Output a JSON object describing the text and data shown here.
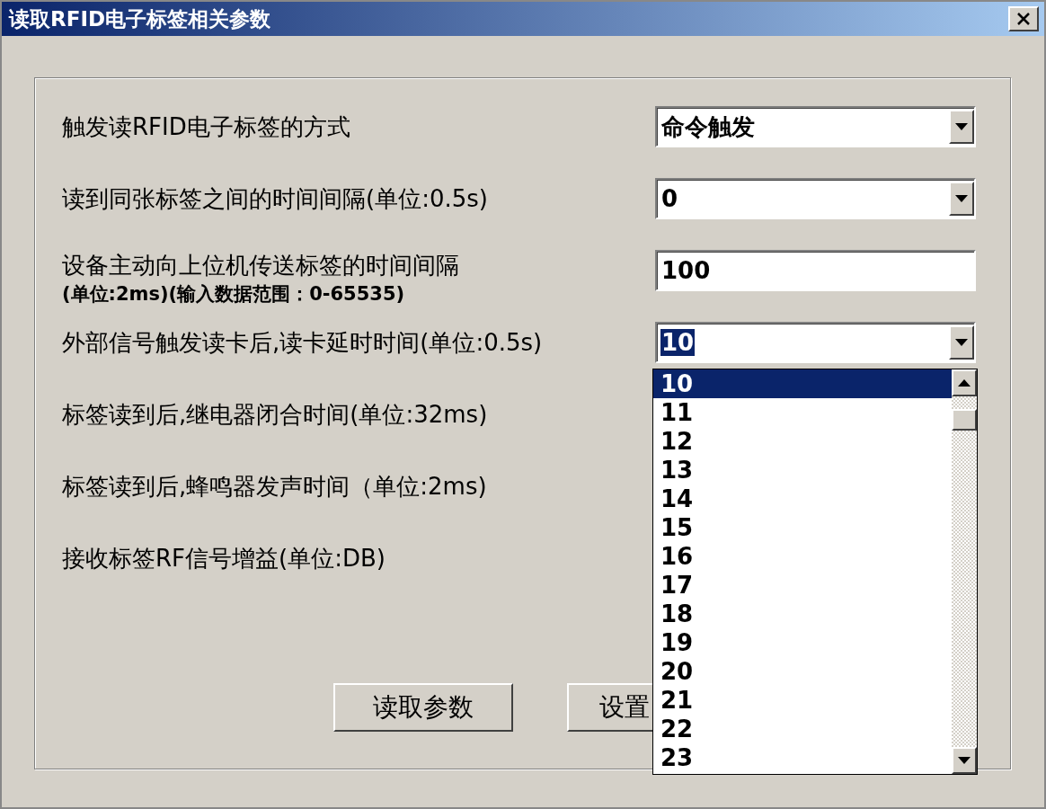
{
  "window": {
    "title": "读取RFID电子标签相关参数"
  },
  "rows": [
    {
      "label": "触发读RFID电子标签的方式",
      "field": {
        "kind": "combo",
        "value": "命令触发",
        "text_selected": false
      }
    },
    {
      "label": "读到同张标签之间的时间间隔(单位:0.5s)",
      "field": {
        "kind": "combo",
        "value": "0",
        "text_selected": false
      }
    },
    {
      "label": "设备主动向上位机传送标签的时间间隔",
      "note": "(单位:2ms)(输入数据范围：0-65535)",
      "field": {
        "kind": "edit",
        "value": "100",
        "text_selected": false
      }
    },
    {
      "label": "外部信号触发读卡后,读卡延时时间(单位:0.5s)",
      "field": {
        "kind": "combo",
        "value": "10",
        "text_selected": true
      }
    },
    {
      "label": "标签读到后,继电器闭合时间(单位:32ms)"
    },
    {
      "label": "标签读到后,蜂鸣器发声时间（单位:2ms)"
    },
    {
      "label": "接收标签RF信号增益(单位:DB)"
    }
  ],
  "buttons": [
    "读取参数",
    "设置"
  ],
  "dropdown_list": {
    "items": [
      {
        "text": "10",
        "selected": true
      },
      {
        "text": "11",
        "selected": false
      },
      {
        "text": "12",
        "selected": false
      },
      {
        "text": "13",
        "selected": false
      },
      {
        "text": "14",
        "selected": false
      },
      {
        "text": "15",
        "selected": false
      },
      {
        "text": "16",
        "selected": false
      },
      {
        "text": "17",
        "selected": false
      },
      {
        "text": "18",
        "selected": false
      },
      {
        "text": "19",
        "selected": false
      },
      {
        "text": "20",
        "selected": false
      },
      {
        "text": "21",
        "selected": false
      },
      {
        "text": "22",
        "selected": false
      },
      {
        "text": "23",
        "selected": false
      }
    ]
  }
}
